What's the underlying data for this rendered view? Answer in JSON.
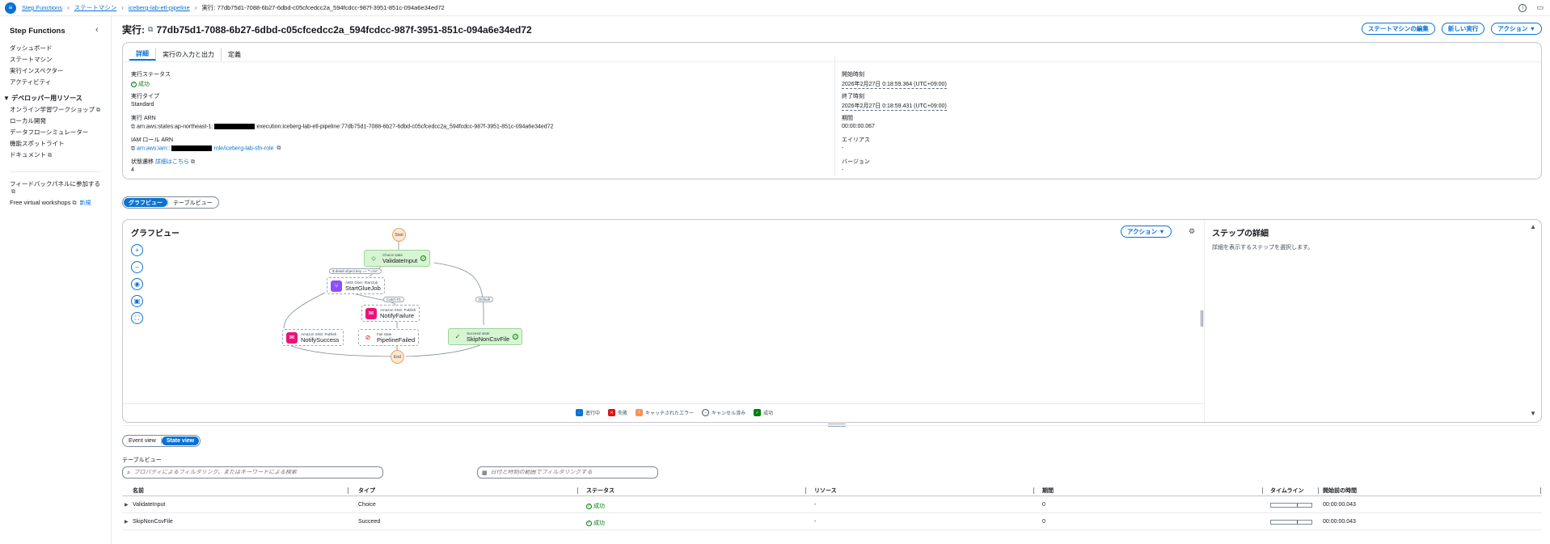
{
  "breadcrumbs": [
    "Step Functions",
    "ステートマシン",
    "iceberg-lab-etl-pipeline",
    "実行: 77db75d1-7088-6b27-6dbd-c05cfcedcc2a_594fcdcc-987f-3951-851c-094a6e34ed72"
  ],
  "sidebar": {
    "title": "Step Functions",
    "items": [
      "ダッシュボード",
      "ステートマシン",
      "実行インスペクター",
      "アクティビティ"
    ],
    "dev_section": "デベロッパー用リソース",
    "dev_items": [
      "オンライン学習ワークショップ",
      "ローカル開発",
      "データフローシミュレーター",
      "機能スポットライト",
      "ドキュメント"
    ],
    "feedback": "フィードバックパネルに参加する",
    "workshops": "Free virtual workshops",
    "new_badge": "新規"
  },
  "header": {
    "title_prefix": "実行:",
    "title_id": "77db75d1-7088-6b27-6dbd-c05cfcedcc2a_594fcdcc-987f-3951-851c-094a6e34ed72",
    "buttons": [
      "ステートマシンの編集",
      "新しい実行",
      "アクション ▼"
    ]
  },
  "details": {
    "tabs": [
      "詳細",
      "実行の入力と出力",
      "定義"
    ],
    "left": {
      "status_label": "実行ステータス",
      "status_value": "成功",
      "type_label": "実行タイプ",
      "type_value": "Standard",
      "arn_label": "実行 ARN",
      "arn_prefix": "arn:aws:states:ap-northeast-1:",
      "arn_suffix": ":execution:iceberg-lab-etl-pipeline:77db75d1-7088-6b27-6dbd-c05cfcedcc2a_594fcdcc-987f-3951-851c-094a6e34ed72",
      "iam_label": "IAM ロール ARN",
      "iam_prefix": "arn:aws:iam::",
      "iam_suffix": ":role/iceberg-lab-sfn-role",
      "transitions_label": "状態遷移",
      "transitions_link": "詳細はこちら",
      "transitions_value": "4"
    },
    "right": {
      "start_label": "開始時刻",
      "start_value": "2026年2月27日 0:18:59.364 (UTC+09:00)",
      "end_label": "終了時刻",
      "end_value": "2026年2月27日 0:18:59.431 (UTC+09:00)",
      "duration_label": "期間",
      "duration_value": "00:00:00.067",
      "alias_label": "エイリアス",
      "alias_value": "-",
      "version_label": "バージョン",
      "version_value": "-"
    }
  },
  "view_toggle": {
    "graph": "グラフビュー",
    "table": "テーブルビュー"
  },
  "graph": {
    "title": "グラフビュー",
    "action_button": "アクション ▼",
    "step_details_title": "ステップの詳細",
    "step_details_desc": "詳細を表示するステップを選択します。",
    "start": "Start",
    "end": "End",
    "nodes": {
      "validate": {
        "type": "Choice state",
        "name": "ValidateInput"
      },
      "glue": {
        "type": "AWS Glue: StartJob",
        "name": "StartGlueJob"
      },
      "failure": {
        "type": "Amazon SNS: Publish",
        "name": "NotifyFailure"
      },
      "success": {
        "type": "Amazon SNS: Publish",
        "name": "NotifySuccess"
      },
      "failed": {
        "type": "Fail state",
        "name": "PipelineFailed"
      },
      "skip": {
        "type": "Succeed state",
        "name": "SkipNonCsvFile"
      }
    },
    "edges": {
      "cond": "$.detail.object.key =~ \"*.csv\"",
      "catch": "Catch #1",
      "default": "Default"
    },
    "legend": [
      "進行中",
      "失敗",
      "キャッチされたエラー",
      "キャンセル済み",
      "成功"
    ]
  },
  "event_toggle": {
    "event": "Event view",
    "state": "State view"
  },
  "table": {
    "label": "テーブルビュー",
    "search_placeholder": "プロパティによるフィルタリング、またはキーワードによる検索",
    "date_placeholder": "日付と時刻の範囲でフィルタリングする",
    "columns": [
      "名前",
      "タイプ",
      "ステータス",
      "リソース",
      "期間",
      "タイムライン",
      "開始前の時間"
    ],
    "rows": [
      {
        "name": "ValidateInput",
        "type": "Choice",
        "status": "成功",
        "resource": "-",
        "duration": "0",
        "start": "00:00:00.043"
      },
      {
        "name": "SkipNonCsvFile",
        "type": "Succeed",
        "status": "成功",
        "resource": "-",
        "duration": "0",
        "start": "00:00:00.043"
      }
    ]
  },
  "colors": {
    "accent": "#0972d3",
    "success": "#037f0c",
    "success_bg": "#d7f5d3",
    "terminal_bg": "#fde7cf"
  },
  "icons": [
    "menu-icon",
    "chevron-left-icon",
    "external-link-icon",
    "copy-icon",
    "status-success-icon",
    "zoom-in-icon",
    "zoom-out-icon",
    "eye-icon",
    "fit-icon",
    "expand-icon",
    "gear-icon",
    "search-icon",
    "calendar-icon",
    "info-icon",
    "notification-icon"
  ]
}
